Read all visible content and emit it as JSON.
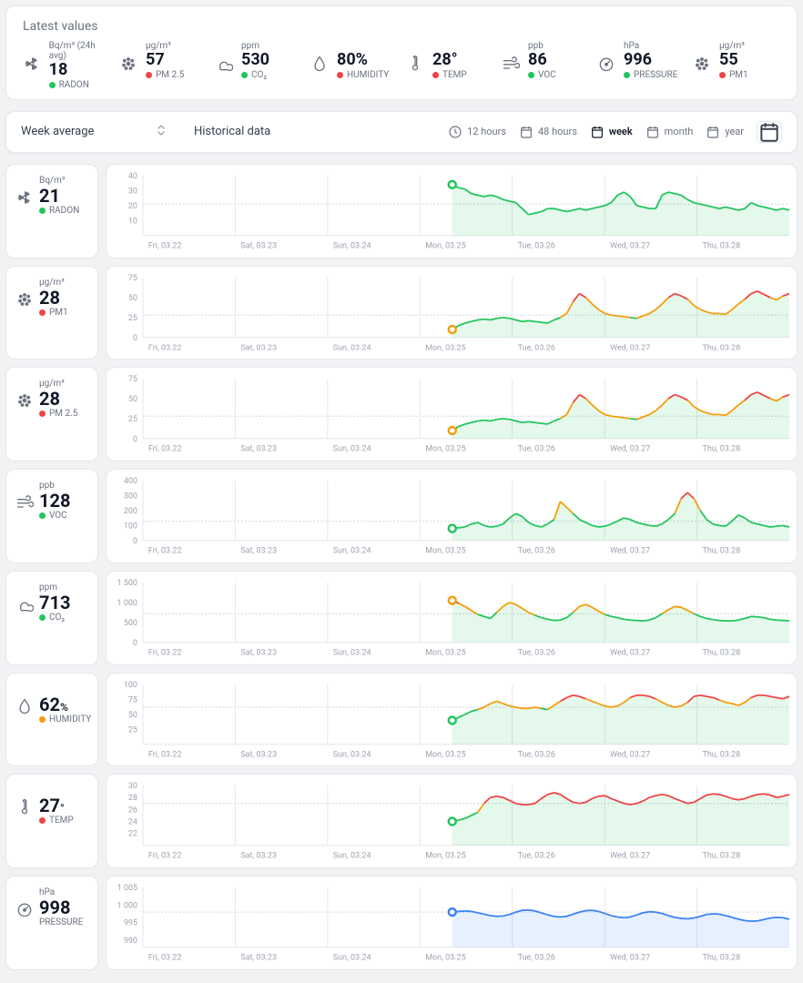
{
  "latest": {
    "title": "Latest values",
    "items": [
      {
        "icon": "radon",
        "unit": "Bq/m³ (24h avg)",
        "value": "18",
        "name": "RADON",
        "dot": "green"
      },
      {
        "icon": "pm",
        "unit": "µg/m³",
        "value": "57",
        "name": "PM 2.5",
        "dot": "red"
      },
      {
        "icon": "co2",
        "unit": "ppm",
        "value": "530",
        "name": "CO₂",
        "dot": "green"
      },
      {
        "icon": "humidity",
        "unit": "",
        "value": "80%",
        "name": "HUMIDITY",
        "dot": "red"
      },
      {
        "icon": "temp",
        "unit": "",
        "value": "28°",
        "name": "TEMP",
        "dot": "red"
      },
      {
        "icon": "voc",
        "unit": "ppb",
        "value": "86",
        "name": "VOC",
        "dot": "green"
      },
      {
        "icon": "pressure",
        "unit": "hPa",
        "value": "996",
        "name": "PRESSURE",
        "dot": "green"
      },
      {
        "icon": "pm",
        "unit": "µg/m³",
        "value": "55",
        "name": "PM1",
        "dot": "red"
      }
    ]
  },
  "controls": {
    "select_label": "Week average",
    "historical": "Historical data",
    "ranges": [
      {
        "id": "12h",
        "label": "12 hours",
        "icon": "clock"
      },
      {
        "id": "48h",
        "label": "48 hours",
        "icon": "cal"
      },
      {
        "id": "week",
        "label": "week",
        "icon": "cal",
        "active": true
      },
      {
        "id": "month",
        "label": "month",
        "icon": "cal"
      },
      {
        "id": "year",
        "label": "year",
        "icon": "cal"
      }
    ]
  },
  "x_categories": [
    "Fri, 03.22",
    "Sat, 03.23",
    "Sun, 03.24",
    "Mon, 03.25",
    "Tue, 03.26",
    "Wed, 03.27",
    "Thu, 03.28"
  ],
  "chart_data": [
    {
      "id": "radon",
      "title": "RADON",
      "unit": "Bq/m³",
      "side_value": "21",
      "dot": "green",
      "type": "line",
      "ylim": [
        0,
        40
      ],
      "yticks": [
        10,
        20,
        30,
        40
      ],
      "baseline": 21,
      "start_day": 3,
      "start_color": "#22c55e",
      "colors": [
        "#22c55e"
      ],
      "values": [
        34,
        32,
        31,
        28,
        27,
        26,
        27,
        26,
        24,
        23,
        22,
        18,
        14,
        15,
        16,
        18,
        18,
        17,
        16,
        17,
        18,
        17,
        18,
        19,
        20,
        22,
        27,
        29,
        26,
        20,
        19,
        18,
        18,
        27,
        29,
        28,
        27,
        24,
        22,
        21,
        20,
        19,
        18,
        19,
        18,
        17,
        18,
        22,
        20,
        19,
        18,
        17,
        18,
        17
      ]
    },
    {
      "id": "pm1",
      "title": "PM1",
      "unit": "µg/m³",
      "side_value": "28",
      "dot": "red",
      "type": "line",
      "ylim": [
        0,
        75
      ],
      "yticks": [
        0,
        25,
        50,
        75
      ],
      "baseline": 28,
      "start_day": 3,
      "start_color": "#f59e0b",
      "segcolors": true,
      "values": [
        10,
        15,
        18,
        20,
        22,
        23,
        22,
        24,
        25,
        24,
        22,
        20,
        21,
        20,
        19,
        18,
        22,
        25,
        30,
        45,
        55,
        50,
        42,
        35,
        30,
        28,
        27,
        26,
        25,
        24,
        27,
        30,
        35,
        42,
        50,
        55,
        52,
        48,
        40,
        35,
        32,
        30,
        30,
        29,
        35,
        42,
        48,
        55,
        58,
        54,
        50,
        47,
        52,
        55
      ]
    },
    {
      "id": "pm25",
      "title": "PM 2.5",
      "unit": "µg/m³",
      "side_value": "28",
      "dot": "red",
      "type": "line",
      "ylim": [
        0,
        75
      ],
      "yticks": [
        0,
        25,
        50,
        75
      ],
      "baseline": 28,
      "start_day": 3,
      "start_color": "#f59e0b",
      "segcolors": true,
      "values": [
        10,
        15,
        18,
        20,
        22,
        23,
        22,
        24,
        25,
        24,
        22,
        20,
        21,
        20,
        19,
        18,
        22,
        25,
        30,
        45,
        55,
        50,
        42,
        35,
        30,
        28,
        27,
        26,
        25,
        24,
        27,
        30,
        35,
        42,
        50,
        55,
        52,
        48,
        40,
        35,
        32,
        30,
        30,
        29,
        35,
        42,
        48,
        55,
        58,
        54,
        50,
        47,
        52,
        55
      ]
    },
    {
      "id": "voc",
      "title": "VOC",
      "unit": "ppb",
      "side_value": "128",
      "dot": "green",
      "type": "line",
      "ylim": [
        0,
        400
      ],
      "yticks": [
        0,
        100,
        200,
        300,
        400
      ],
      "baseline": 128,
      "start_day": 3,
      "start_color": "#22c55e",
      "segcolors": true,
      "thresh_y": 180,
      "thresh_r": 300,
      "values": [
        80,
        85,
        90,
        110,
        120,
        100,
        90,
        95,
        110,
        150,
        180,
        160,
        120,
        100,
        90,
        110,
        140,
        260,
        220,
        180,
        140,
        120,
        100,
        90,
        95,
        110,
        130,
        150,
        140,
        120,
        110,
        100,
        95,
        110,
        140,
        180,
        280,
        320,
        280,
        200,
        140,
        110,
        100,
        95,
        130,
        170,
        150,
        120,
        110,
        100,
        90,
        95,
        100,
        90
      ]
    },
    {
      "id": "co2",
      "title": "CO₂",
      "unit": "ppm",
      "side_value": "713",
      "dot": "green",
      "type": "line",
      "ylim": [
        0,
        1500
      ],
      "yticks": [
        0,
        500,
        1000,
        1500
      ],
      "baseline": 713,
      "start_day": 3,
      "start_color": "#f59e0b",
      "segcolors": true,
      "thresh_y": 700,
      "thresh_r": 1000,
      "values": [
        1050,
        980,
        900,
        800,
        700,
        650,
        600,
        750,
        900,
        1000,
        950,
        850,
        750,
        680,
        620,
        580,
        550,
        560,
        620,
        750,
        900,
        950,
        880,
        780,
        700,
        650,
        620,
        580,
        560,
        550,
        540,
        560,
        620,
        720,
        820,
        900,
        880,
        800,
        720,
        650,
        600,
        570,
        550,
        540,
        540,
        560,
        600,
        650,
        640,
        620,
        580,
        560,
        550,
        540
      ]
    },
    {
      "id": "humidity",
      "title": "HUMIDITY",
      "unit": "",
      "side_value": "62",
      "suffix": "%",
      "dot": "yellow",
      "type": "line",
      "ylim": [
        0,
        100
      ],
      "yticks": [
        25,
        50,
        75,
        100
      ],
      "baseline": 62,
      "start_day": 3,
      "start_color": "#22c55e",
      "segcolors": true,
      "thresh_y": 60,
      "thresh_r": 75,
      "values": [
        40,
        45,
        50,
        55,
        58,
        62,
        68,
        72,
        68,
        64,
        62,
        60,
        60,
        62,
        60,
        58,
        65,
        72,
        78,
        82,
        80,
        76,
        72,
        68,
        64,
        62,
        64,
        70,
        78,
        82,
        82,
        80,
        76,
        70,
        65,
        62,
        64,
        70,
        80,
        82,
        80,
        78,
        74,
        70,
        68,
        65,
        70,
        78,
        82,
        82,
        80,
        78,
        76,
        80
      ]
    },
    {
      "id": "temp",
      "title": "TEMP",
      "unit": "",
      "side_value": "27",
      "suffix": "°",
      "dot": "red",
      "type": "line",
      "ylim": [
        20,
        30
      ],
      "yticks": [
        22,
        24,
        26,
        28,
        30
      ],
      "baseline": 27,
      "start_day": 3,
      "start_color": "#22c55e",
      "segcolors": true,
      "thresh_y": 25.5,
      "thresh_r": 26.5,
      "values": [
        24,
        24.2,
        24.5,
        25,
        25.5,
        27,
        28,
        28.2,
        28,
        27.5,
        27,
        26.8,
        26.8,
        27,
        27.8,
        28.5,
        28.8,
        28.5,
        27.8,
        27.2,
        27,
        27.2,
        27.8,
        28.2,
        28.3,
        27.8,
        27.4,
        27,
        26.8,
        27,
        27.4,
        28,
        28.3,
        28.5,
        28.3,
        27.8,
        27.4,
        27,
        27.2,
        27.8,
        28.4,
        28.6,
        28.5,
        28.2,
        27.8,
        27.6,
        27.8,
        28.2,
        28.5,
        28.6,
        28.4,
        28,
        28.2,
        28.5
      ]
    },
    {
      "id": "pressure",
      "title": "PRESSURE",
      "unit": "hPa",
      "side_value": "998",
      "dot": "",
      "type": "line",
      "ylim": [
        988,
        1005
      ],
      "yticks": [
        990,
        995,
        1000,
        1005
      ],
      "baseline": 998,
      "start_day": 3,
      "start_color": "#3b82f6",
      "colors": [
        "#3b82f6"
      ],
      "values": [
        998,
        998.2,
        998.3,
        998.2,
        997.8,
        997.4,
        997,
        996.8,
        996.9,
        997.3,
        998,
        998.5,
        998.6,
        998.3,
        997.8,
        997.2,
        996.8,
        996.6,
        996.8,
        997.4,
        998,
        998.4,
        998.5,
        998.2,
        997.6,
        997,
        996.6,
        996.4,
        996.6,
        997.2,
        997.8,
        998.1,
        998,
        997.6,
        997,
        996.5,
        996.2,
        996.1,
        996.3,
        996.8,
        997.3,
        997.5,
        997.4,
        997,
        996.5,
        996,
        995.6,
        995.4,
        995.5,
        995.9,
        996.3,
        996.5,
        996.4,
        996
      ]
    }
  ]
}
